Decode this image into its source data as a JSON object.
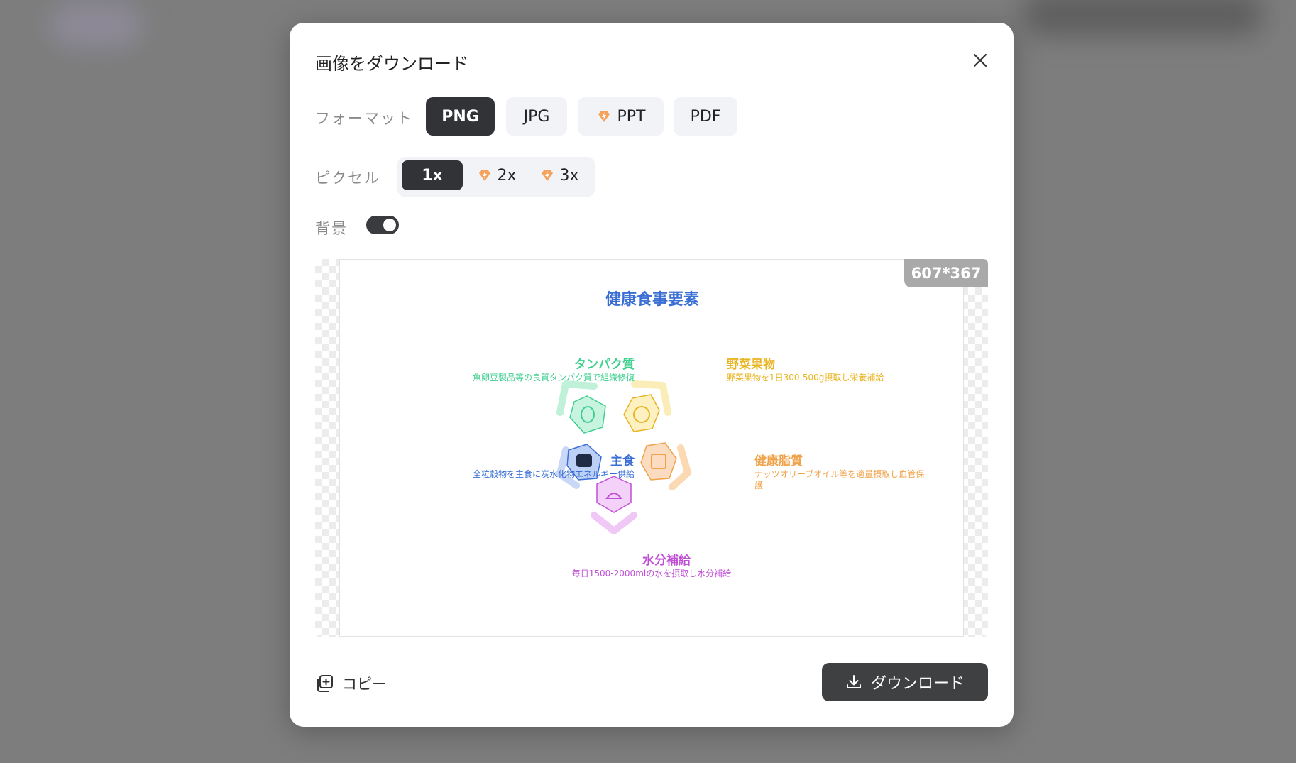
{
  "dialog": {
    "title": "画像をダウンロード",
    "format_label": "フォーマット",
    "pixel_label": "ピクセル",
    "background_label": "背景",
    "background_on": true,
    "formats": [
      {
        "label": "PNG",
        "active": true,
        "premium": false
      },
      {
        "label": "JPG",
        "active": false,
        "premium": false
      },
      {
        "label": "PPT",
        "active": false,
        "premium": true
      },
      {
        "label": "PDF",
        "active": false,
        "premium": false
      }
    ],
    "pixels": [
      {
        "label": "1x",
        "active": true,
        "premium": false
      },
      {
        "label": "2x",
        "active": false,
        "premium": true
      },
      {
        "label": "3x",
        "active": false,
        "premium": true
      }
    ],
    "preview_size": "607*367",
    "copy_label": "コピー",
    "download_label": "ダウンロード"
  },
  "preview": {
    "title": "健康食事要素",
    "items": [
      {
        "heading": "タンパク質",
        "desc": "魚卵豆製品等の良質タンパク質で組織修復",
        "color": "#3fcf8e",
        "icon": "egg-icon"
      },
      {
        "heading": "野菜果物",
        "desc": "野菜果物を1日300-500g摂取し栄養補給",
        "color": "#e9b422",
        "icon": "tomato-icon"
      },
      {
        "heading": "主食",
        "desc": "全粒穀物を主食に炭水化物エネルギー供給",
        "color": "#3b6fd6",
        "icon": "rice-bowl-icon"
      },
      {
        "heading": "健康脂質",
        "desc": "ナッツオリーブオイル等を適量摂取し血管保護",
        "color": "#f0a24a",
        "icon": "oil-bottle-icon"
      },
      {
        "heading": "水分補給",
        "desc": "毎日1500-2000mlの水を摂取し水分補給",
        "color": "#c04fd6",
        "icon": "duck-icon"
      }
    ]
  },
  "colors": {
    "dark_button": "#323336",
    "premium_gem": "#f5a25d",
    "overlay": "#7d7d7d"
  }
}
